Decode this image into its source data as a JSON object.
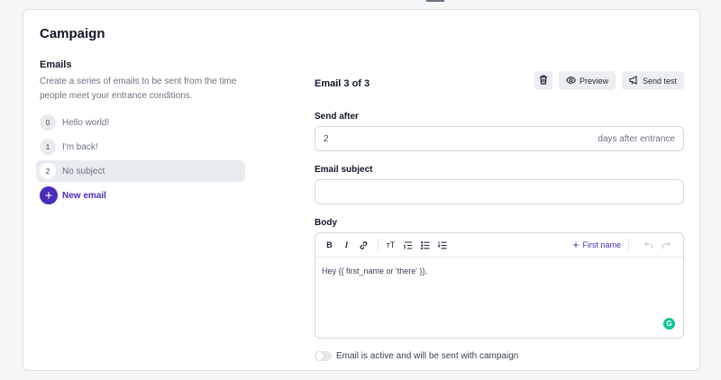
{
  "page": {
    "title": "Campaign"
  },
  "emails": {
    "heading": "Emails",
    "description": "Create a series of emails to be sent from the time people meet your entrance conditions.",
    "items": [
      {
        "number": "0",
        "label": "Hello world!"
      },
      {
        "number": "1",
        "label": "I'm back!"
      },
      {
        "number": "2",
        "label": "No subject",
        "selected": true
      }
    ],
    "new_email_label": "New email"
  },
  "editor": {
    "counter": "Email 3 of 3",
    "actions": {
      "delete_icon": "trash-icon",
      "preview_label": "Preview",
      "preview_icon": "eye-icon",
      "send_test_label": "Send test",
      "send_test_icon": "megaphone-icon"
    },
    "send_after": {
      "label": "Send after",
      "value": "2",
      "suffix": "days after entrance"
    },
    "subject": {
      "label": "Email subject",
      "value": ""
    },
    "body": {
      "label": "Body",
      "toolbar": {
        "bold": "B",
        "italic": "I",
        "text_size": "тT",
        "insert_variable_label": "First name"
      },
      "content": "Hey {{ first_name or 'there' }},"
    },
    "active_toggle": {
      "label": "Email is active and will be sent with campaign",
      "on": false
    }
  },
  "colors": {
    "accent": "#4c2bb8",
    "grammarly": "#15c39a"
  }
}
